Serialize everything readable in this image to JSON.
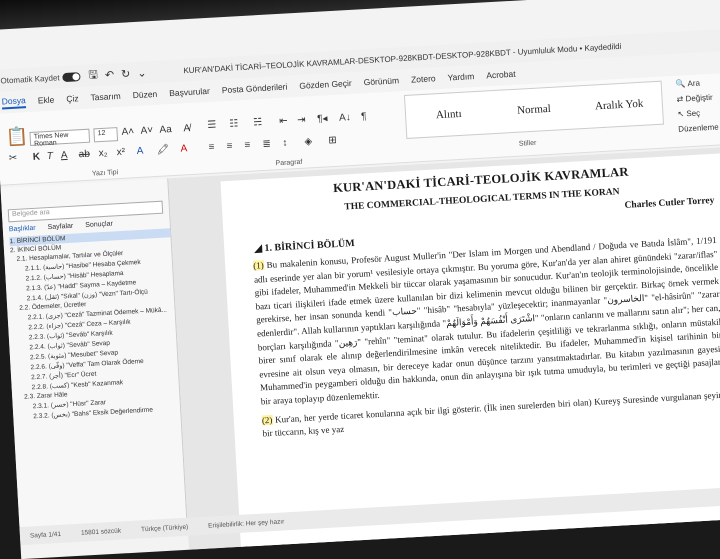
{
  "titlebar": {
    "autosave_label": "Otomatik Kaydet",
    "doc_title": "KUR'AN'DAKİ TİCARİ–TEOLOJİK KAVRAMLAR-DESKTOP-928KBDT-DESKTOP-928KBDT  -  Uyumluluk Modu  •  Kaydedildi"
  },
  "menu": [
    "Dosya",
    "Ekle",
    "Çiz",
    "Tasarım",
    "Düzen",
    "Başvurular",
    "Posta Gönderileri",
    "Gözden Geçir",
    "Görünüm",
    "Zotero",
    "Yardım",
    "Acrobat"
  ],
  "ribbon": {
    "font_name": "Times New Roman",
    "font_size": "12",
    "font_group_label": "Yazı Tipi",
    "paragraph_group_label": "Paragraf",
    "styles_group_label": "Stiller",
    "styles": [
      "Alıntı",
      "Normal",
      "Aralık Yok"
    ],
    "right_tools": [
      "Ara",
      "Değiştir",
      "Seç",
      "Düzenleme"
    ]
  },
  "navpane": {
    "search_placeholder": "Belgede ara",
    "tabs": [
      "Başlıklar",
      "Sayfalar",
      "Sonuçlar"
    ],
    "items": [
      "1. BİRİNCİ BÖLÜM",
      "2. İKİNCİ BÖLÜM",
      "2.1. Hesaplamalar, Tartılar ve Ölçüler",
      "2.1.1. (حاسبة) \"Hasibe\" Hesaba Çekmek",
      "2.1.2. (حساب) \"Hisâb\" Hesaplama",
      "2.1.3. (عدّ) \"Hadd\" Sayma – Kaydetme",
      "2.1.4. (ثقل) \"Sıkal\" (وزن) \"Vezn\" Tartı-Ölçü",
      "2.2. Ödemeler, Ücretler",
      "2.2.1. (جزى) \"Cezâ\" Tazminat Ödemek – Mükâ...",
      "2.2.2. (جزاء) \"Cezâ\" Ceza – Karşılık",
      "2.2.3. (ثواب) \"Sevâb\" Karşılık",
      "2.2.4. (ثواب) \"Sevâb\" Sevap",
      "2.2.5. (مثوبة) \"Mesubet\" Sevap",
      "2.2.6. (وفّى) \"Veffa\" Tam Olarak Ödeme",
      "2.2.7. (أجر) \"Ecr\" Ücret",
      "2.2.8. (كسب) \"Kesb\" Kazanmak",
      "2.3. Zarar Hâle",
      "2.3.1. (خسر) \"Hüsr\" Zarar",
      "2.3.2. (بخس) \"Bahs\" Eksik Değerlendirme"
    ]
  },
  "document": {
    "title": "KUR'AN'DAKİ TİCARİ-TEOLOJİK KAVRAMLAR",
    "subtitle": "THE COMMERCIAL-THEOLOGICAL TERMS IN THE KORAN",
    "author": "Charles Cutler Torrey",
    "heading": "1.  BİRİNCİ BÖLÜM",
    "p1_num": "(1)",
    "p1_text": " Bu makalenin konusu, Profesör August Muller'in \"Der Islam im Morgen und Abendland / Doğuda ve Batıda İslâm\", 1/191 adlı eserinde yer alan bir yorum¹ vesilesiyle ortaya çıkmıştır. Bu yoruma göre, Kur'an'da yer alan ahiret günündeki \"zarar/iflas\" gibi ifadeler, Muhammed'in Mekkeli bir tüccar olarak yaşamasının bir sonucudur. Kur'an'ın teolojik terminolojisinde, öncelikle bazı ticari ilişkileri ifade etmek üzere kullanılan bir dizi kelimenin mevcut olduğu bilinen bir gerçektir. Birkaç örnek vermek gerekirse, her insan sonunda kendi \"حساب\" \"hisâb\" \"hesabıyla\" yüzleşecektir; inanmayanlar \"الخاسرون\" \"el-hâsirûn\" \"zarar edenlerdir\". Allah kullarının yaptıkları karşılığında \"اشْتَرَى أَنْفُسَهُمْ وَأَمْوَالَهُمْ\" \"onların canlarını ve mallarını satın alır\"; her can, borçları karşılığında \"رَهِين\" \"rehîn\" \"teminat\" olarak tutulur. Bu ifadelerin çeşitliliği ve tekrarlanma sıklığı, onların müstakil birer sınıf olarak ele alınıp değerlendirilmesine imkân verecek niteliktedir. Bu ifadeler, Muhammed'in kişisel tarihinin bir evresine ait olsun veya olmasın, bir dereceye kadar onun düşünce tarzını yansıtmaktadırlar. Bu kitabın yazılmasının gayesi, Muhammed'in peygamberi olduğu din hakkında, onun din anlayışına bir ışık tutma umuduyla, bu terimleri ve geçtiği pasajları bir araya toplayıp düzenlemektir.",
    "p2_num": "(2)",
    "p2_text": " Kur'an, her yerde ticaret konularına açık bir ilgi gösterir. (İlk inen surelerden biri olan) Kureyş Suresinde vurgulanan şeyin, bir tüccarın, kış ve yaz"
  },
  "statusbar": [
    "Sayfa 1/41",
    "15801 sözcük",
    "Türkçe (Türkiye)",
    "Erişilebilirlik: Her şey hazır"
  ]
}
